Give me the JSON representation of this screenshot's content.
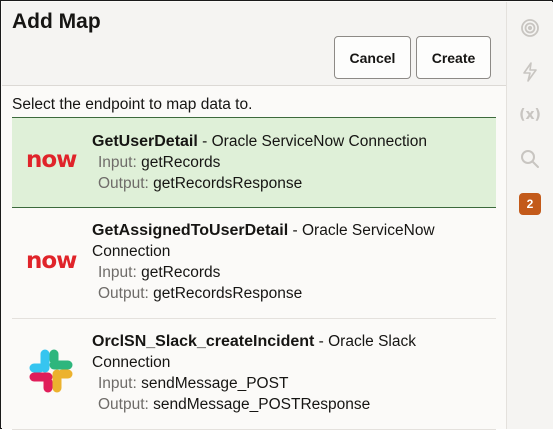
{
  "header": {
    "title": "Add Map",
    "cancel_label": "Cancel",
    "create_label": "Create"
  },
  "prompt": "Select the endpoint to map data to.",
  "endpoints": [
    {
      "name": "GetUserDetail",
      "connection": " - Oracle ServiceNow Connection",
      "input_label": "Input:",
      "input_value": " getRecords",
      "output_label": "Output:",
      "output_value": " getRecordsResponse",
      "logo": "now",
      "selected": true
    },
    {
      "name": "GetAssignedToUserDetail",
      "connection": " - Oracle ServiceNow Connection",
      "input_label": "Input:",
      "input_value": " getRecords",
      "output_label": "Output:",
      "output_value": " getRecordsResponse",
      "logo": "now",
      "selected": false
    },
    {
      "name": "OrclSN_Slack_createIncident",
      "connection": " - Oracle Slack Connection",
      "input_label": "Input:",
      "input_value": " sendMessage_POST",
      "output_label": "Output:",
      "output_value": " sendMessage_POSTResponse",
      "logo": "slack-logo",
      "selected": false
    }
  ],
  "rail": {
    "icons": [
      "target-icon",
      "bolt-icon",
      "variable-icon",
      "search-icon"
    ],
    "fx_label": "(x)",
    "badge_count": "2"
  },
  "colors": {
    "selected_bg": "#dff0d8",
    "servicenow_red": "#e0242a",
    "badge": "#c35a1a"
  }
}
